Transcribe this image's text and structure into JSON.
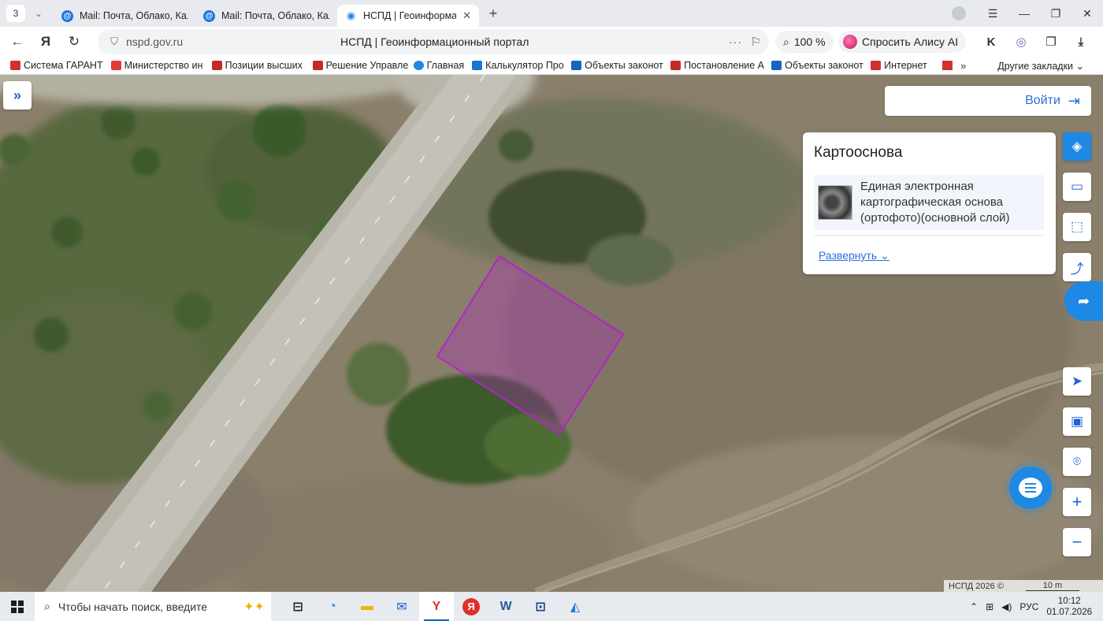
{
  "browser": {
    "tab_counter": "3",
    "tabs": [
      {
        "title": "Mail: Почта, Облако, Кале"
      },
      {
        "title": "Mail: Почта, Облако, Кале"
      },
      {
        "title": "НСПД | Геоинформаци"
      }
    ],
    "url": "nspd.gov.ru",
    "page_title": "НСПД | Геоинформационный портал",
    "zoom": "100 %",
    "alice_label": "Спросить Алису AI"
  },
  "bookmarks": {
    "items": [
      {
        "label": "Система ГАРАНТ",
        "color": "#d32f2f"
      },
      {
        "label": "Министерство ин",
        "color": "#e53935"
      },
      {
        "label": "Позиции высших",
        "color": "#c62828"
      },
      {
        "label": "Решение Управле",
        "color": "#c62828"
      },
      {
        "label": "Главная",
        "color": "#1e88e5"
      },
      {
        "label": "Калькулятор Про",
        "color": "#1976d2"
      },
      {
        "label": "Объекты законот",
        "color": "#1565c0"
      },
      {
        "label": "Постановление А",
        "color": "#c62828"
      },
      {
        "label": "Объекты законот",
        "color": "#1565c0"
      },
      {
        "label": "Интернет ",
        "color": "#d32f2f"
      }
    ],
    "more": "»",
    "other": "Другие закладки"
  },
  "map": {
    "login_label": "Войти",
    "basemap_title": "Картооснова",
    "basemap_layer": "Единая электронная картографическая основа (ортофото)(основной слой)",
    "expand_label": "Развернуть",
    "copyright": "НСПД 2026 ©",
    "scale": "10 m",
    "parcel_color": "#b324c8"
  },
  "taskbar": {
    "search_placeholder": "Чтобы начать поиск, введите",
    "lang": "РУС",
    "time": "10:12",
    "date": "01.07.2026"
  }
}
